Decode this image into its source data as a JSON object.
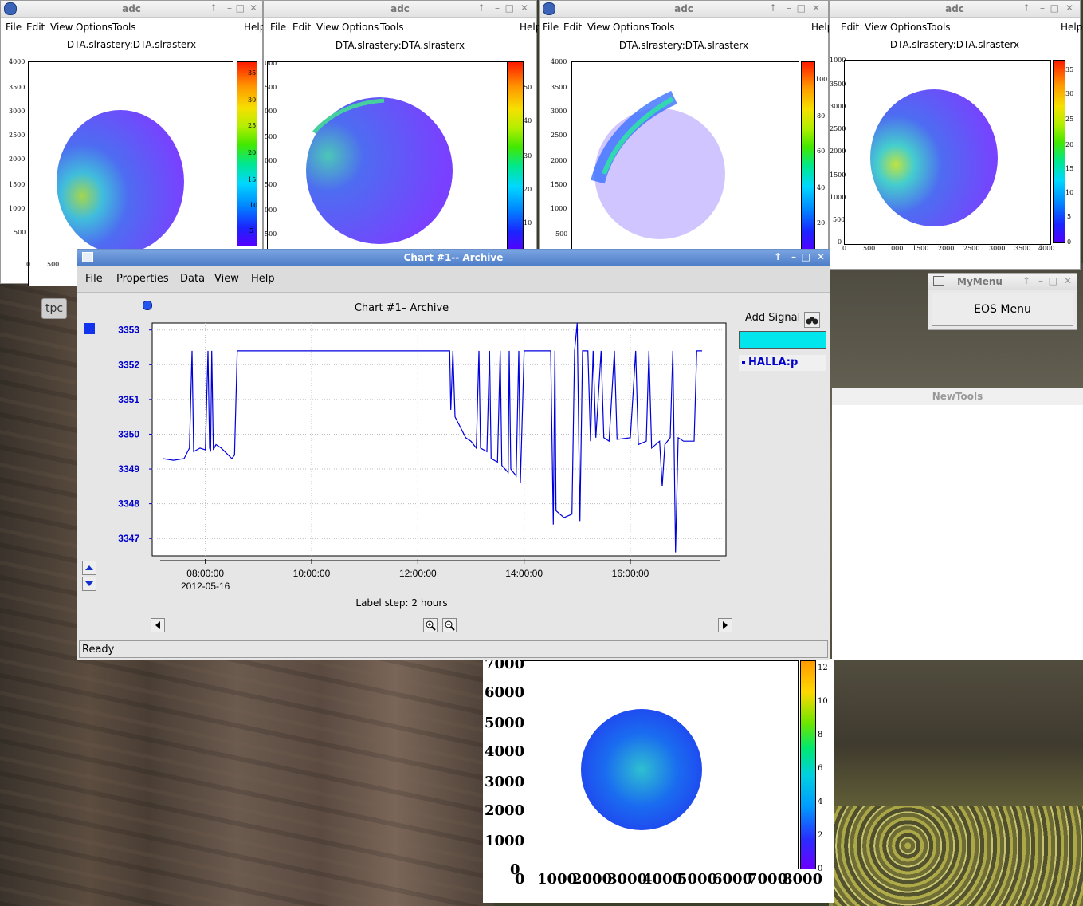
{
  "rasters": [
    {
      "window_title": "adc",
      "plot_title": "DTA.slrastery:DTA.slrasterx",
      "menu": [
        "File",
        "Edit",
        "View",
        "Options",
        "Tools",
        "Help"
      ],
      "yticks": [
        "4000",
        "3500",
        "3000",
        "2500",
        "2000",
        "1500",
        "1000",
        "500"
      ],
      "xticks": [
        "0",
        "500"
      ],
      "cticks": [
        "35",
        "30",
        "25",
        "20",
        "15",
        "10",
        "5"
      ]
    },
    {
      "window_title": "adc",
      "plot_title": "DTA.slrastery:DTA.slrasterx",
      "menu": [
        "File",
        "Edit",
        "View",
        "Options",
        "Tools",
        "Help"
      ],
      "yticks": [
        "000",
        "500",
        "000",
        "500",
        "000",
        "500",
        "000",
        "500"
      ],
      "cticks": [
        "50",
        "40",
        "30",
        "20",
        "10"
      ]
    },
    {
      "window_title": "adc",
      "plot_title": "DTA.slrastery:DTA.slrasterx",
      "menu": [
        "File",
        "Edit",
        "View",
        "Options",
        "Tools",
        "Help"
      ],
      "yticks": [
        "4000",
        "3500",
        "3000",
        "2500",
        "2000",
        "1500",
        "1000",
        "500"
      ],
      "cticks": [
        "100",
        "80",
        "60",
        "40",
        "20"
      ]
    },
    {
      "window_title": "adc",
      "plot_title": "DTA.slrastery:DTA.slrasterx",
      "menu": [
        "File",
        "Edit",
        "View",
        "Options",
        "Tools",
        "Help"
      ],
      "yticks": [
        "1000",
        "3500",
        "3000",
        "2500",
        "2000",
        "1500",
        "1000",
        "500",
        "0"
      ],
      "xticks": [
        "0",
        "500",
        "1000",
        "1500",
        "2000",
        "2500",
        "3000",
        "3500",
        "4000"
      ],
      "cticks": [
        "35",
        "30",
        "25",
        "20",
        "15",
        "10",
        "5",
        "0"
      ]
    }
  ],
  "chart_window": {
    "title": "Chart #1-- Archive",
    "menu": [
      "File",
      "Properties",
      "Data",
      "View",
      "Help"
    ],
    "chart_title": "Chart #1– Archive",
    "add_signal": "Add Signal",
    "legend_signal": "HALLA:p",
    "label_step": "Label step: 2 hours",
    "date": "2012-05-16",
    "status": "Ready"
  },
  "chart_data": {
    "type": "line",
    "title": "Chart #1– Archive",
    "x_tick_labels": [
      "08:00:00",
      "10:00:00",
      "12:00:00",
      "14:00:00",
      "16:00:00"
    ],
    "ylim": [
      3346.5,
      3353.2
    ],
    "y_tick_labels": [
      "3353",
      "3352",
      "3351",
      "3350",
      "3349",
      "3348",
      "3347"
    ],
    "grid": true,
    "series": [
      {
        "name": "HALLA:p",
        "color": "#0000dd",
        "points": [
          [
            7.2,
            3349.3
          ],
          [
            7.4,
            3349.25
          ],
          [
            7.6,
            3349.3
          ],
          [
            7.7,
            3349.6
          ],
          [
            7.75,
            3352.4
          ],
          [
            7.78,
            3349.5
          ],
          [
            7.9,
            3349.6
          ],
          [
            8.0,
            3349.55
          ],
          [
            8.05,
            3352.4
          ],
          [
            8.08,
            3349.6
          ],
          [
            8.1,
            3349.5
          ],
          [
            8.12,
            3352.4
          ],
          [
            8.15,
            3349.55
          ],
          [
            8.2,
            3349.7
          ],
          [
            8.3,
            3349.6
          ],
          [
            8.4,
            3349.45
          ],
          [
            8.5,
            3349.3
          ],
          [
            8.55,
            3349.4
          ],
          [
            8.6,
            3352.4
          ],
          [
            9.0,
            3352.4
          ],
          [
            11.0,
            3352.4
          ],
          [
            12.6,
            3352.4
          ],
          [
            12.62,
            3350.7
          ],
          [
            12.66,
            3352.4
          ],
          [
            12.7,
            3350.5
          ],
          [
            12.8,
            3350.2
          ],
          [
            12.9,
            3349.9
          ],
          [
            13.0,
            3349.8
          ],
          [
            13.1,
            3349.6
          ],
          [
            13.15,
            3352.4
          ],
          [
            13.18,
            3349.6
          ],
          [
            13.3,
            3349.5
          ],
          [
            13.35,
            3352.4
          ],
          [
            13.38,
            3349.3
          ],
          [
            13.5,
            3349.2
          ],
          [
            13.55,
            3352.4
          ],
          [
            13.58,
            3349.1
          ],
          [
            13.7,
            3348.9
          ],
          [
            13.72,
            3352.4
          ],
          [
            13.75,
            3349.0
          ],
          [
            13.85,
            3348.8
          ],
          [
            13.9,
            3352.4
          ],
          [
            13.93,
            3348.6
          ],
          [
            14.0,
            3352.4
          ],
          [
            14.5,
            3352.4
          ],
          [
            14.55,
            3347.4
          ],
          [
            14.58,
            3352.4
          ],
          [
            14.6,
            3347.8
          ],
          [
            14.75,
            3347.6
          ],
          [
            14.9,
            3347.7
          ],
          [
            14.95,
            3352.4
          ],
          [
            15.0,
            3353.2
          ],
          [
            15.05,
            3347.5
          ],
          [
            15.1,
            3352.4
          ],
          [
            15.2,
            3352.4
          ],
          [
            15.25,
            3349.8
          ],
          [
            15.3,
            3352.4
          ],
          [
            15.35,
            3349.9
          ],
          [
            15.45,
            3352.4
          ],
          [
            15.5,
            3349.9
          ],
          [
            15.6,
            3349.8
          ],
          [
            15.7,
            3352.4
          ],
          [
            15.75,
            3349.85
          ],
          [
            16.0,
            3349.9
          ],
          [
            16.1,
            3352.4
          ],
          [
            16.15,
            3349.7
          ],
          [
            16.3,
            3349.8
          ],
          [
            16.35,
            3352.4
          ],
          [
            16.4,
            3349.6
          ],
          [
            16.55,
            3349.8
          ],
          [
            16.6,
            3348.5
          ],
          [
            16.65,
            3349.7
          ],
          [
            16.75,
            3349.9
          ],
          [
            16.8,
            3352.4
          ],
          [
            16.85,
            3346.6
          ],
          [
            16.9,
            3349.9
          ],
          [
            17.0,
            3349.8
          ],
          [
            17.2,
            3349.8
          ],
          [
            17.25,
            3352.4
          ],
          [
            17.35,
            3352.4
          ]
        ]
      }
    ],
    "xlim_hours": [
      7.0,
      17.8
    ]
  },
  "tpc_label": "tpc",
  "mymenu": {
    "title": "MyMenu",
    "button": "EOS Menu"
  },
  "newtools": {
    "title": "NewTools"
  },
  "bottom_hist": {
    "yticks": [
      "7000",
      "6000",
      "5000",
      "4000",
      "3000",
      "2000",
      "1000",
      "0"
    ],
    "xticks": [
      "0",
      "1000",
      "2000",
      "3000",
      "4000",
      "5000",
      "6000",
      "7000",
      "8000"
    ],
    "cticks": [
      "12",
      "10",
      "8",
      "6",
      "4",
      "2",
      "0"
    ]
  }
}
